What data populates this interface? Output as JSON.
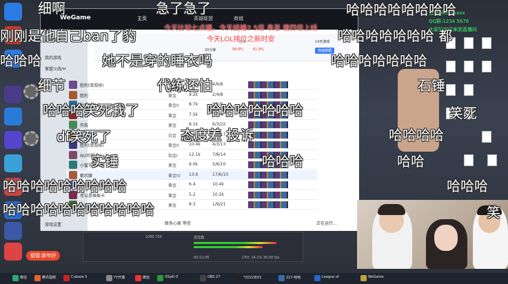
{
  "wegame": {
    "logo": "WeGame",
    "tabs": [
      "主页",
      "英雄联盟",
      "商城"
    ],
    "side_items": [
      "游戏设置",
      "我的游戏",
      "掌盟火线/H"
    ],
    "header_stats": [
      "20分钟",
      "58.6%",
      "61.8%",
      "14天游戏"
    ],
    "winrate_label": "胜率",
    "filter_label": "筛选数据",
    "rows": [
      {
        "name": "胜利(单双排)",
        "rank": "黄金II",
        "kda": "11.6k",
        "score": "4/6/8"
      },
      {
        "name": "胜利",
        "rank": "黄金",
        "kda": "9.2k",
        "score": "2/4/8"
      },
      {
        "name": "胜利的最佳",
        "rank": "黄金II",
        "kda": "8.7k",
        "score": "5/2/9"
      },
      {
        "name": "胜利",
        "rank": "黄金",
        "kda": "7.5k",
        "score": "3/5/6"
      },
      {
        "name": "失败",
        "rank": "黄金",
        "kda": "8.1k",
        "score": "6/3/22"
      },
      {
        "name": "失败",
        "rank": "白金",
        "kda": "9.9k",
        "score": "8/9/17"
      },
      {
        "name": "胜利(单双排)",
        "rank": "黄金II",
        "kda": "10.4k",
        "score": "4/3/13"
      },
      {
        "name": "NO可嗯内人",
        "rank": "铂金I",
        "kda": "12.1k",
        "score": "7/8/14"
      },
      {
        "name": "小蜜东东开心",
        "rank": "黄金",
        "kda": "9.0k",
        "score": "5/6/10"
      },
      {
        "name": "都怼腰",
        "rank": "黄金IV",
        "kda": "13.6",
        "score": "17/6/10"
      },
      {
        "name": "中王奇格楼",
        "rank": "黄金",
        "kda": "6.4",
        "score": "10.4k"
      },
      {
        "name": "可以是格根卡",
        "rank": "黄金",
        "kda": "5.2",
        "score": "10.2k"
      },
      {
        "name": "新风流流地",
        "rank": "黄金",
        "kda": "8.3",
        "score": "1/9/21"
      }
    ],
    "bottom_left": "游戏设置",
    "bottom_mid": "联系心家 等信",
    "bottom_right": "正在运行..."
  },
  "obs": {
    "scene": "1080 720",
    "source": "混音器",
    "time": "00:11:06",
    "cpu": "CPU: 14.1%  30.00 fps"
  },
  "taskbar": {
    "items": [
      "微信",
      "腾讯视频",
      "Cubase 5",
      "YY开播",
      "微信",
      "XSplit 0",
      "OBS 27",
      "*2022年01",
      "227-哈哈",
      "League of",
      "WeGame"
    ]
  },
  "danmaku": [
    "细啊",
    "急了急了",
    "哈哈哈哈哈哈哈哈",
    "刚刚是他自己ban了豹",
    "哈哈哈哈哈哈哈 都",
    "哈哈哈",
    "她不是穿的睡衣吗",
    "哈哈哈哈哈哈哈",
    "细节",
    "代练还怕",
    "石锤",
    "哈哈哈笑死我了",
    "哈哈哈哈哈哈哈",
    "笑死",
    "df笑死了",
    "态度差 投诉",
    "哈哈哈哈",
    "实锤",
    "哈哈哈",
    "哈哈",
    "哈哈哈哈哈哈哈哈哈",
    "哈哈哈",
    "哈哈哈哈哈哈哈哈哈哈哈",
    "笑"
  ],
  "red_danmaku": [
    "今天比较七点播，今天结婚2.5倍 表恶 唐四倍上线",
    "今天LOL排位之新时安"
  ],
  "green_text": [
    "直播间:9xxxxxx",
    "QQ群:1234 5678",
    "大家好欢迎来到直播间"
  ],
  "live_badge": "德德:新年好"
}
